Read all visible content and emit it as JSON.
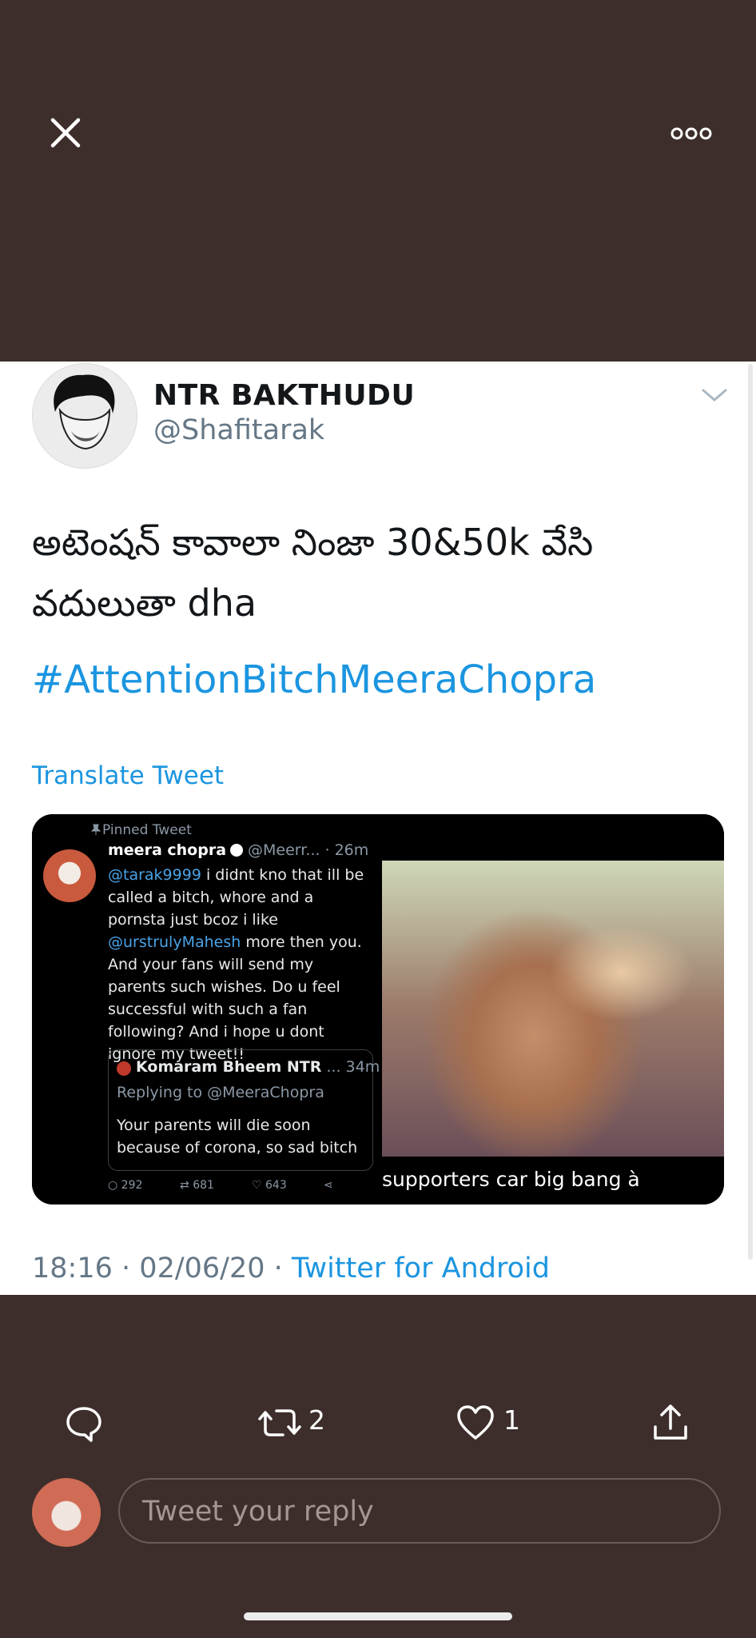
{
  "top_bar": {
    "close_icon": "close-icon",
    "more_icon": "more-options-icon"
  },
  "tweet": {
    "display_name": "NTR BAKTHUDU",
    "handle": "@Shafitarak",
    "text": "అటెంషన్ కావాలా నింజా 30&50k వేసి వదులుతా dha",
    "hashtag": "#AttentionBitchMeeraChopra",
    "translate_label": "Translate Tweet",
    "time": "18:16",
    "date": "02/06/20",
    "separator": "·",
    "source": "Twitter for Android"
  },
  "media_left": {
    "pinned": "Pinned Tweet",
    "name": "meera chopra",
    "handle_time": "@Meerr... · 26m",
    "mention": "@tarak9999",
    "body_1": " i didnt kno that ill be called a bitch, whore and a pornsta just bcoz i like ",
    "mention_2": "@urstrulyMahesh",
    "body_2": " more then you. And your fans will send my parents such wishes. Do u feel successful with such a fan following? And i hope u dont ignore my tweet!!",
    "quote_name": "Komaram Bheem NTR",
    "quote_time": "... 34m",
    "quote_reply": "Replying to @MeeraChopra",
    "quote_text": "Your parents will die soon\nbecause of corona, so sad bitch",
    "replies": "292",
    "retweets": "681",
    "likes": "643"
  },
  "media_right": {
    "caption": "supporters car big bang à"
  },
  "actions": {
    "reply_icon": "reply-icon",
    "retweet_icon": "retweet-icon",
    "retweet_count": "2",
    "like_icon": "heart-icon",
    "like_count": "1",
    "share_icon": "share-icon"
  },
  "reply": {
    "placeholder": "Tweet your reply"
  },
  "colors": {
    "background": "#3d2e2b",
    "card": "#ffffff",
    "link": "#1b95e0",
    "muted": "#657786"
  }
}
